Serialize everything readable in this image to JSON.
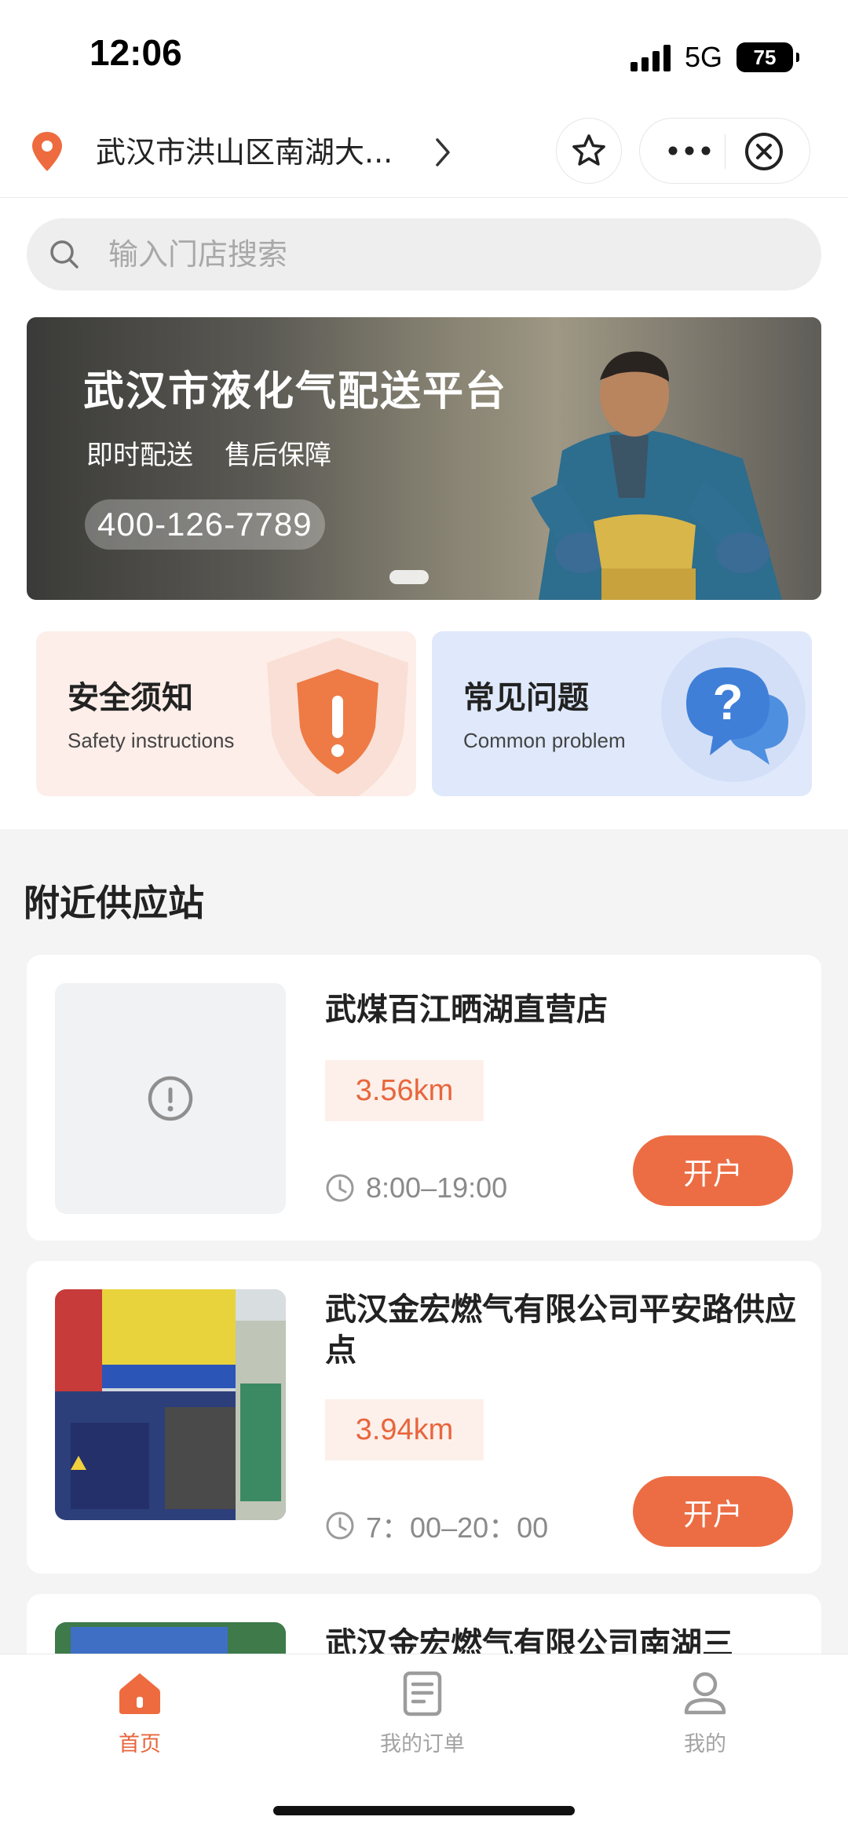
{
  "status_bar": {
    "time": "12:06",
    "network": "5G",
    "battery": "75"
  },
  "header": {
    "location": "武汉市洪山区南湖大...",
    "icons": [
      "location-pin-icon",
      "chevron-right-icon",
      "star-icon",
      "more-icon",
      "close-circle-icon"
    ]
  },
  "search": {
    "placeholder": "输入门店搜索",
    "value": ""
  },
  "banner": {
    "title": "武汉市液化气配送平台",
    "tag1": "即时配送",
    "tag2": "售后保障",
    "phone": "400-126-7789"
  },
  "quick_links": [
    {
      "title": "安全须知",
      "subtitle": "Safety instructions",
      "icon": "shield-icon"
    },
    {
      "title": "常见问题",
      "subtitle": "Common problem",
      "icon": "chat-question-icon"
    }
  ],
  "section_title": "附近供应站",
  "stations": [
    {
      "name": "武煤百江晒湖直营店",
      "distance": "3.56km",
      "hours": "8:00–19:00",
      "action": "开户"
    },
    {
      "name": "武汉金宏燃气有限公司平安路供应点",
      "distance": "3.94km",
      "hours": "7：00–20：00",
      "action": "开户"
    },
    {
      "name": "武汉金宏燃气有限公司南湖三",
      "distance": "",
      "hours": "",
      "action": ""
    }
  ],
  "tabs": [
    {
      "label": "首页",
      "icon": "home-icon",
      "active": true
    },
    {
      "label": "我的订单",
      "icon": "orders-icon",
      "active": false
    },
    {
      "label": "我的",
      "icon": "user-icon",
      "active": false
    }
  ],
  "colors": {
    "accent": "#ec6d44",
    "accent_text": "#e8663d",
    "distance_bg": "#fdf0ea"
  }
}
